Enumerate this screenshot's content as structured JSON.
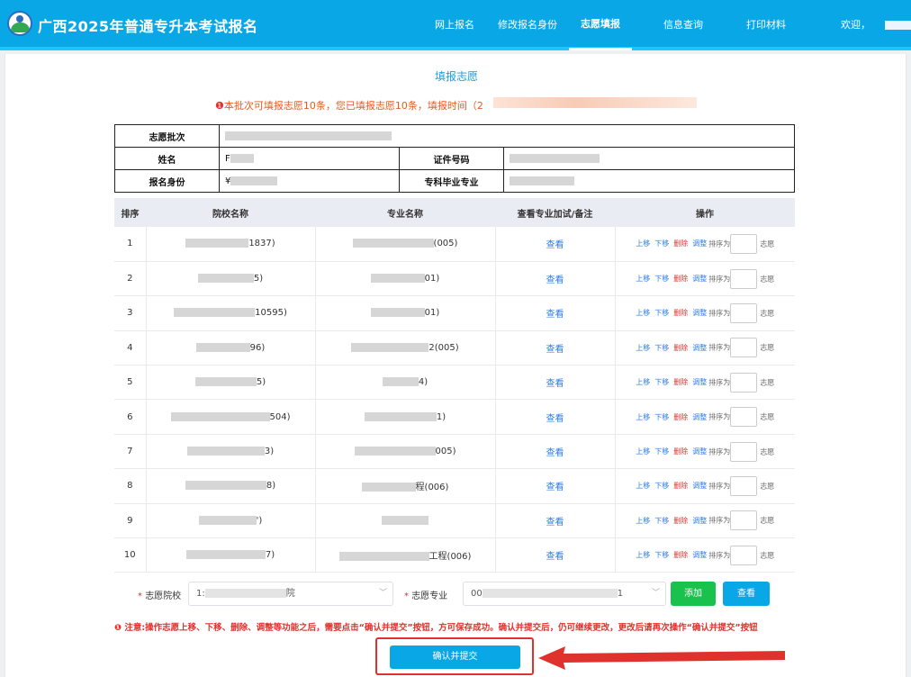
{
  "header": {
    "title": "广西2025年普通专升本考试报名",
    "nav": [
      "网上报名",
      "修改报名身份",
      "志愿填报",
      "信息查询",
      "打印材料"
    ],
    "active_nav": "志愿填报",
    "welcome": "欢迎，"
  },
  "page": {
    "title": "填报志愿",
    "notice": "本批次可填报志愿10条，您已填报志愿10条，填报时间（2"
  },
  "info_table": {
    "batch_label": "志愿批次",
    "name_label": "姓名",
    "id_label": "证件号码",
    "identity_label": "报名身份",
    "major_label": "专科毕业专业",
    "name_value_prefix": "F",
    "identity_value_prefix": "¥"
  },
  "grid": {
    "headers": [
      "排序",
      "院校名称",
      "专业名称",
      "查看专业加试/备注",
      "操作"
    ],
    "view_label": "查看",
    "ops": {
      "up": "上移",
      "down": "下移",
      "del": "删除",
      "adjust": "调整",
      "order_prefix": "排序为",
      "order_suffix": "志愿"
    },
    "rows": [
      {
        "num": "1",
        "school_tail": "1837)",
        "major_tail": "(005)"
      },
      {
        "num": "2",
        "school_tail": "5)",
        "major_tail": "01)"
      },
      {
        "num": "3",
        "school_tail": "10595)",
        "major_tail": "01)"
      },
      {
        "num": "4",
        "school_tail": "96)",
        "major_tail": "2(005)"
      },
      {
        "num": "5",
        "school_tail": "5)",
        "major_tail": "4)"
      },
      {
        "num": "6",
        "school_tail": "504)",
        "major_tail": "1)"
      },
      {
        "num": "7",
        "school_tail": "3)",
        "major_tail": "005)"
      },
      {
        "num": "8",
        "school_tail": "8)",
        "major_tail": "程(006)"
      },
      {
        "num": "9",
        "school_tail": "')",
        "major_tail": ""
      },
      {
        "num": "10",
        "school_tail": "7)",
        "major_tail": "工程(006)"
      }
    ]
  },
  "form": {
    "school_label": "志愿院校",
    "school_value_prefix": "1:",
    "school_value_suffix": "院",
    "major_label": "志愿专业",
    "major_value_prefix": "00",
    "major_value_suffix": "1",
    "add_label": "添加",
    "query_label": "查看"
  },
  "warning": "注意:操作志愿上移、下移、删除、调整等功能之后，需要点击“确认并提交”按钮，方可保存成功。确认并提交后，仍可继续更改，更改后请再次操作“确认并提交”按钮",
  "submit_label": "确认并提交",
  "colors": {
    "brand": "#0aa7e6",
    "danger": "#e0322c",
    "success": "#19c24c",
    "link": "#2d7de6"
  }
}
